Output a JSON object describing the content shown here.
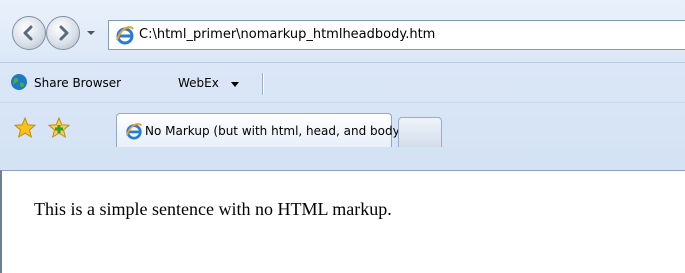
{
  "toolbar": {
    "back_icon": "back-arrow-icon",
    "forward_icon": "forward-arrow-icon",
    "address": "C:\\html_primer\\nomarkup_htmlheadbody.htm"
  },
  "links_bar": {
    "share_browser": "Share Browser",
    "webex": "WebEx"
  },
  "tabs": {
    "active_title": "No Markup (but with html, head, and body tags)"
  },
  "page": {
    "text": "This is a simple sentence with no HTML markup."
  }
}
